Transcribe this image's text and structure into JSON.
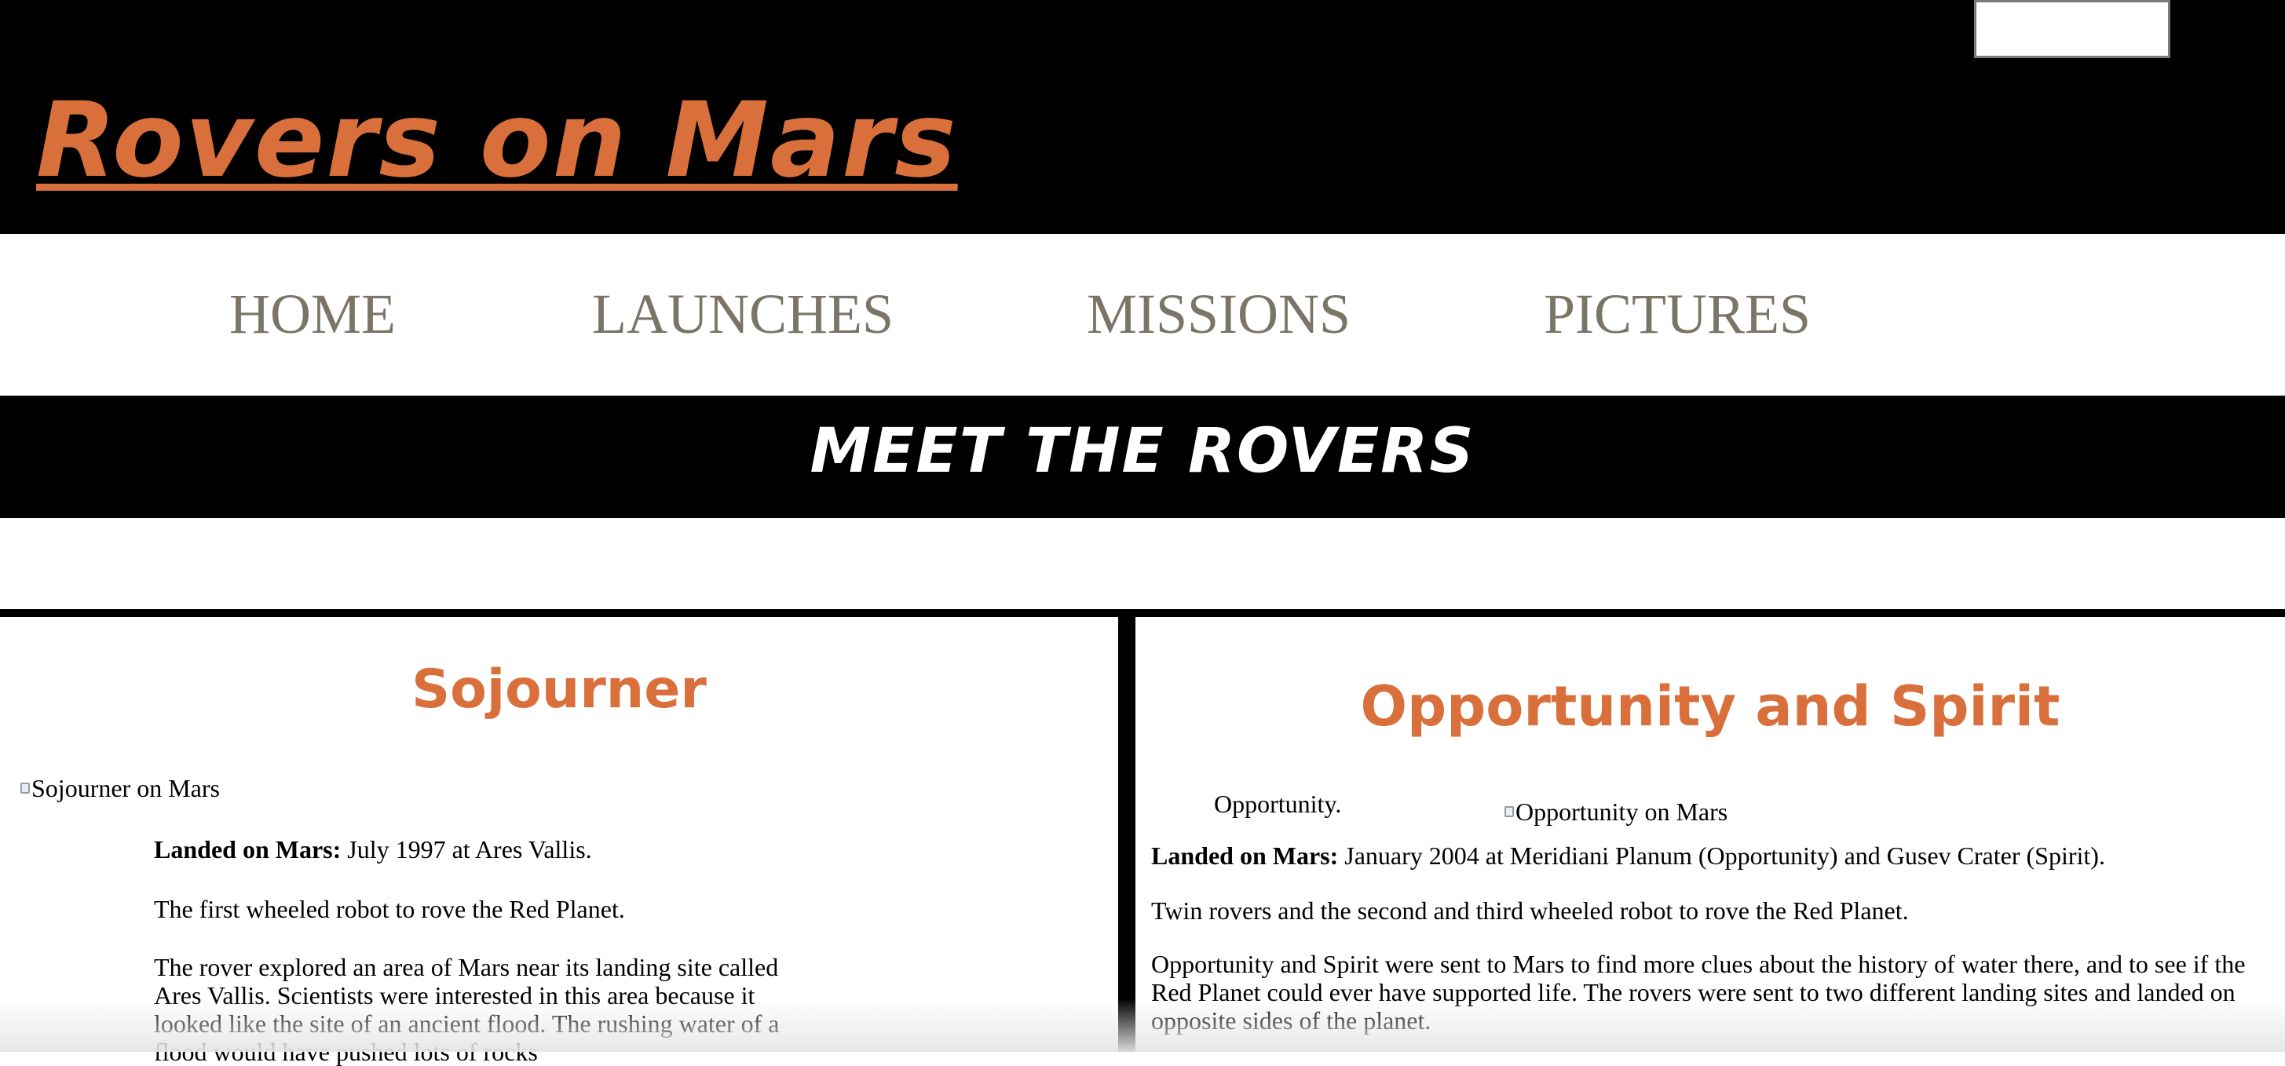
{
  "header": {
    "site_title": "Rovers on Mars"
  },
  "nav": {
    "items": [
      {
        "label": "HOME"
      },
      {
        "label": "LAUNCHES"
      },
      {
        "label": "MISSIONS"
      },
      {
        "label": "PICTURES"
      }
    ]
  },
  "banner": {
    "title": "MEET THE ROVERS"
  },
  "sojourner": {
    "title": "Sojourner",
    "image_alt": "Sojourner on Mars",
    "landed_label": "Landed on Mars:",
    "landed_value": " July 1997 at Ares Vallis.",
    "fact": "The first wheeled robot to rove the Red Planet.",
    "description": "The rover explored an area of Mars near its landing site called Ares Vallis. Scientists were interested in this area because it looked like the site of an ancient flood. The rushing water of a flood would have pushed lots of rocks"
  },
  "opportunity_spirit": {
    "title": "Opportunity and Spirit",
    "caption": "Opportunity.",
    "image_alt": "Opportunity on Mars",
    "landed_label": "Landed on Mars:",
    "landed_value": " January 2004 at Meridiani Planum (Opportunity) and Gusev Crater (Spirit).",
    "fact": "Twin rovers and the second and third wheeled robot to rove the Red Planet.",
    "description": "Opportunity and Spirit were sent to Mars to find more clues about the history of water there, and to see if the Red Planet could ever have supported life. The rovers were sent to two different landing sites and landed on opposite sides of the planet."
  },
  "colors": {
    "accent": "#d9703c",
    "nav_text": "#7a7566",
    "header_bg": "#000000"
  }
}
